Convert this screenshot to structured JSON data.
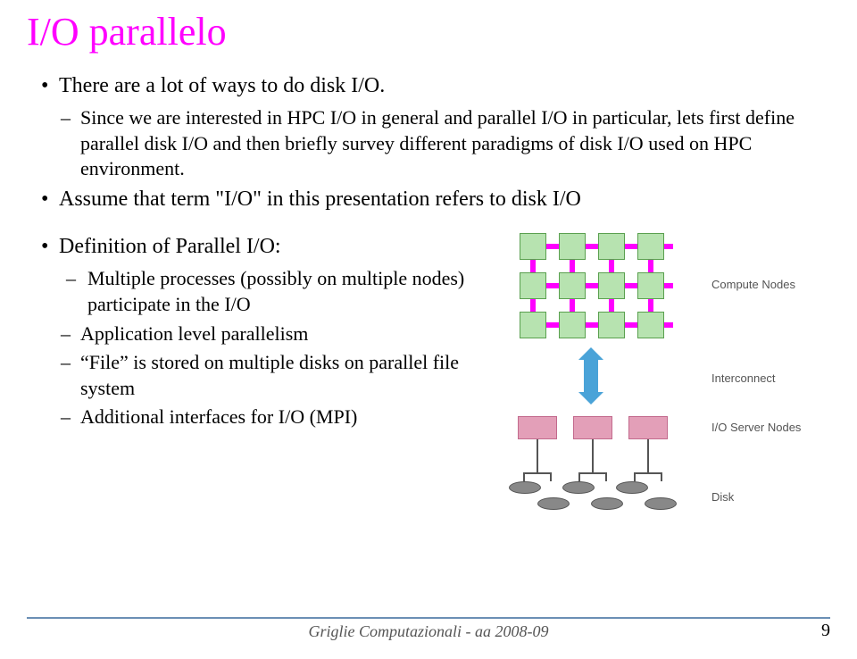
{
  "title": "I/O parallelo",
  "bullets_top": [
    "There are a lot of ways to do disk I/O.",
    "Assume that term \"I/O\" in this presentation refers to disk I/O"
  ],
  "sub_top": "Since we are interested in HPC I/O in general and parallel I/O in particular, lets first define parallel disk I/O and then briefly survey different paradigms of disk I/O used on HPC environment.",
  "bullet_def": "Definition of Parallel I/O:",
  "def_items": [
    " Multiple processes (possibly on multiple nodes) participate in the I/O",
    "Application level parallelism",
    "“File” is stored on multiple disks on parallel file system",
    "Additional interfaces for I/O (MPI)"
  ],
  "diagram": {
    "labels": {
      "compute": "Compute Nodes",
      "interconnect": "Interconnect",
      "server": "I/O Server Nodes",
      "disk": "Disk"
    }
  },
  "footer": "Griglie Computazionali - aa 2008-09",
  "page": "9"
}
